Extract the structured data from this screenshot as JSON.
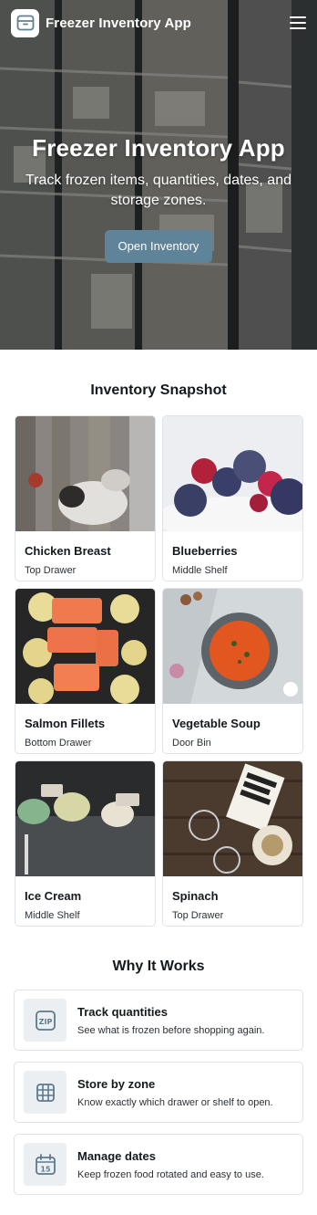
{
  "header": {
    "brand": "Freezer Inventory App",
    "logo_icon": "box-icon",
    "menu_icon": "hamburger-menu-icon"
  },
  "hero": {
    "title": "Freezer Inventory App",
    "subtitle": "Track frozen items, quantities, dates, and storage zones.",
    "button_label": "Open Inventory",
    "button_color": "#5f8398"
  },
  "snapshot": {
    "title": "Inventory Snapshot",
    "items": [
      {
        "name": "Chicken Breast",
        "zone": "Top Drawer"
      },
      {
        "name": "Blueberries",
        "zone": "Middle Shelf"
      },
      {
        "name": "Salmon Fillets",
        "zone": "Bottom Drawer"
      },
      {
        "name": "Vegetable Soup",
        "zone": "Door Bin"
      },
      {
        "name": "Ice Cream",
        "zone": "Middle Shelf"
      },
      {
        "name": "Spinach",
        "zone": "Top Drawer"
      }
    ]
  },
  "why": {
    "title": "Why It Works",
    "features": [
      {
        "title": "Track quantities",
        "desc": "See what is frozen before shopping again.",
        "icon": "zip-icon"
      },
      {
        "title": "Store by zone",
        "desc": "Know exactly which drawer or shelf to open.",
        "icon": "grid-icon"
      },
      {
        "title": "Manage dates",
        "desc": "Keep frozen food rotated and easy to use.",
        "icon": "calendar-icon",
        "icon_text": "15"
      }
    ]
  }
}
